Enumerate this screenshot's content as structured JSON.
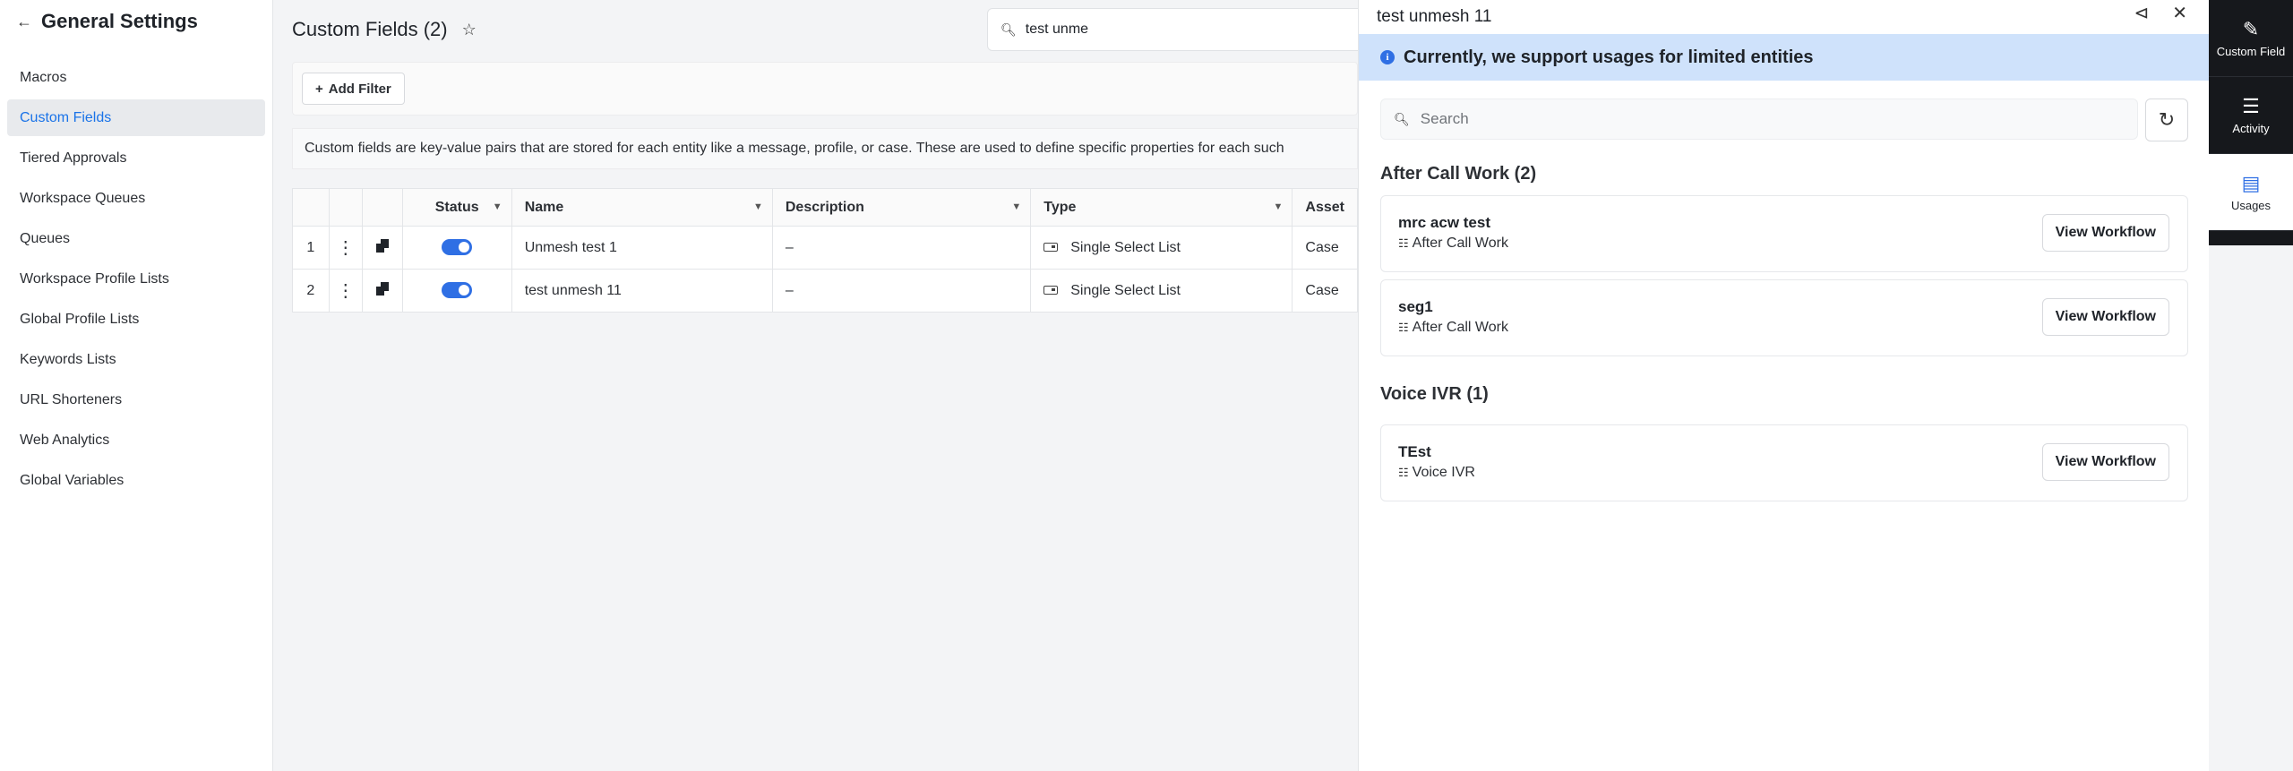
{
  "sidebar": {
    "title": "General Settings",
    "items": [
      {
        "label": "Macros",
        "active": false
      },
      {
        "label": "Custom Fields",
        "active": true
      },
      {
        "label": "Tiered Approvals",
        "active": false
      },
      {
        "label": "Workspace Queues",
        "active": false
      },
      {
        "label": "Queues",
        "active": false
      },
      {
        "label": "Workspace Profile Lists",
        "active": false
      },
      {
        "label": "Global Profile Lists",
        "active": false
      },
      {
        "label": "Keywords Lists",
        "active": false
      },
      {
        "label": "URL Shorteners",
        "active": false
      },
      {
        "label": "Web Analytics",
        "active": false
      },
      {
        "label": "Global Variables",
        "active": false
      }
    ]
  },
  "main": {
    "title": "Custom Fields (2)",
    "search_value": "test unme",
    "add_filter_label": "Add Filter",
    "info_text": "Custom fields are key-value pairs that are stored for each entity like a message, profile, or case. These are used to define specific properties for each such",
    "table": {
      "columns": [
        "Status",
        "Name",
        "Description",
        "Type",
        "Asset"
      ],
      "rows": [
        {
          "index": "1",
          "status_on": true,
          "name": "Unmesh test 1",
          "description": "–",
          "type": "Single Select List",
          "asset": "Case"
        },
        {
          "index": "2",
          "status_on": true,
          "name": "test unmesh 11",
          "description": "–",
          "type": "Single Select List",
          "asset": "Case"
        }
      ]
    }
  },
  "panel": {
    "title": "test unmesh 11",
    "notice": "Currently, we support usages for limited entities",
    "search_placeholder": "Search",
    "sections": [
      {
        "title": "After Call Work (2)",
        "items": [
          {
            "name": "mrc acw test",
            "sub": "After Call Work",
            "button": "View Workflow"
          },
          {
            "name": "seg1",
            "sub": "After Call Work",
            "button": "View Workflow"
          }
        ]
      },
      {
        "title": "Voice IVR (1)",
        "items": [
          {
            "name": "TEst",
            "sub": "Voice IVR",
            "button": "View Workflow"
          }
        ]
      }
    ]
  },
  "rail": {
    "items": [
      {
        "label": "Custom Field",
        "icon": "edit-icon"
      },
      {
        "label": "Activity",
        "icon": "activity-icon"
      },
      {
        "label": "Usages",
        "icon": "usages-icon"
      }
    ]
  },
  "colors": {
    "accent": "#2f6fe4",
    "notice_bg": "#cfe2fb",
    "rail_bg": "#16181c"
  }
}
